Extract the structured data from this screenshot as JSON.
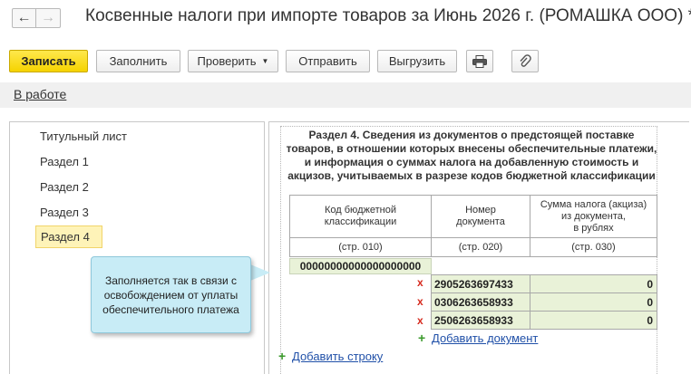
{
  "header": {
    "back": "←",
    "forward": "→",
    "title": "Косвенные налоги при импорте товаров за Июнь 2026 г. (РОМАШКА ООО) *"
  },
  "toolbar": {
    "save": "Записать",
    "fill": "Заполнить",
    "check": "Проверить",
    "send": "Отправить",
    "upload": "Выгрузить"
  },
  "status": "В работе",
  "nav": [
    "Титульный лист",
    "Раздел 1",
    "Раздел 2",
    "Раздел 3",
    "Раздел 4"
  ],
  "section": {
    "heading_lines": [
      "Раздел 4. Сведения из документов о предстоящей поставке",
      "товаров, в отношении которых внесены обеспечительные платежи,",
      "и информация о суммах налога на добавленную стоимость и",
      "акцизов, учитываемых в разрезе кодов бюджетной классификации"
    ],
    "columns": [
      {
        "header_lines": [
          "Код бюджетной",
          "классификации"
        ],
        "code": "(стр. 010)"
      },
      {
        "header_lines": [
          "Номер",
          "документа"
        ],
        "code": "(стр. 020)"
      },
      {
        "header_lines": [
          "Сумма налога (акциза)",
          "из документа,",
          "в рублях"
        ],
        "code": "(стр. 030)"
      }
    ],
    "kbk": "00000000000000000000",
    "rows": [
      {
        "number": "2905263697433",
        "sum": "0"
      },
      {
        "number": "0306263658933",
        "sum": "0"
      },
      {
        "number": "2506263658933",
        "sum": "0"
      }
    ],
    "delete_mark": "x",
    "plus": "+",
    "add_document": "Добавить документ",
    "add_row": "Добавить строку"
  },
  "tooltip": {
    "lines": [
      "Заполняется так в связи с",
      "освобождением от уплаты",
      "обеспечительного платежа"
    ]
  },
  "colors": {
    "primary_button": "#f5d300",
    "active_nav": "#fef3b8",
    "input_cell": "#e9f2d8",
    "tooltip": "#c8ecf6",
    "link": "#2050a8",
    "delete": "#d62a1e",
    "add": "#3a9a2b"
  }
}
